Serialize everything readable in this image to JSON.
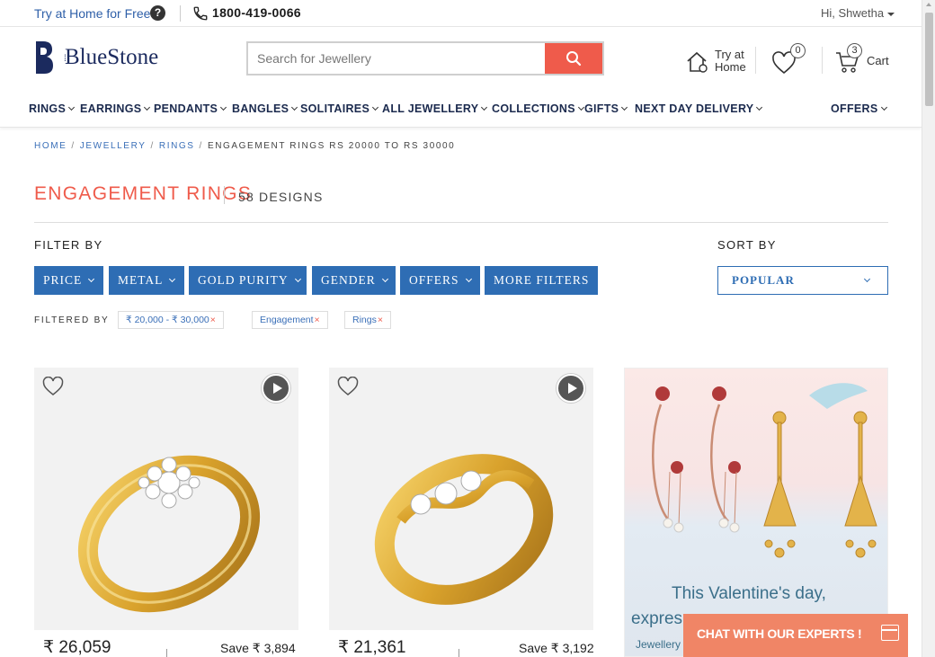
{
  "topbar": {
    "try_home": "Try at Home for Free",
    "help": "?",
    "phone": "1800-419-0066",
    "greeting": "Hi, Shwetha"
  },
  "header": {
    "logo": "BlueStone",
    "search_placeholder": "Search for Jewellery",
    "try_at": "Try at",
    "home": "Home",
    "wishlist_count": "0",
    "cart_count": "3",
    "cart": "Cart"
  },
  "nav": {
    "items": [
      "RINGS",
      "EARRINGS",
      "PENDANTS",
      "BANGLES",
      "SOLITAIRES",
      "ALL JEWELLERY",
      "COLLECTIONS",
      "GIFTS",
      "NEXT DAY DELIVERY",
      "OFFERS"
    ]
  },
  "breadcrumb": [
    "HOME",
    "JEWELLERY",
    "RINGS",
    "ENGAGEMENT RINGS RS 20000 TO RS 30000"
  ],
  "page": {
    "title": "ENGAGEMENT RINGS",
    "count": "58 DESIGNS"
  },
  "filters": {
    "label": "FILTER BY",
    "buttons": [
      "PRICE",
      "METAL",
      "GOLD PURITY",
      "GENDER",
      "OFFERS",
      "MORE FILTERS"
    ],
    "sort_label": "SORT BY",
    "sort_value": "POPULAR",
    "filtered_by": "FILTERED BY",
    "chips": [
      "₹ 20,000 - ₹ 30,000",
      "Engagement",
      "Rings"
    ],
    "chip_remove": "×"
  },
  "products": [
    {
      "price": "₹ 26,059",
      "save": "Save ₹ 3,894"
    },
    {
      "price": "₹ 21,361",
      "save": "Save ₹ 3,192"
    }
  ],
  "promo": {
    "line1": "This Valentine's day,",
    "line2": "expres",
    "line3": "Jewellery"
  },
  "chat": {
    "label": "CHAT WITH OUR EXPERTS !"
  },
  "colors": {
    "accent": "#ef5b4b",
    "primary": "#2e6db4",
    "navy": "#1b2a4e",
    "chat": "#f08566"
  }
}
